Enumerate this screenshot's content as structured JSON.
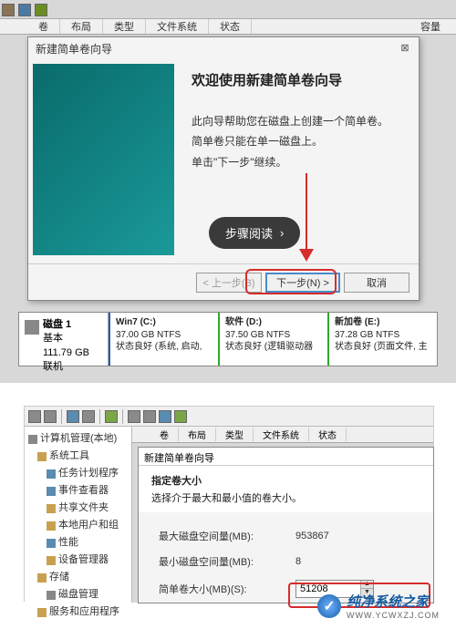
{
  "section1": {
    "toolbar": {
      "cols": [
        "卷",
        "布局",
        "类型",
        "文件系统",
        "状态"
      ],
      "last": "容量"
    },
    "wizard": {
      "title": "新建简单卷向导",
      "heading": "欢迎使用新建简单卷向导",
      "line1": "此向导帮助您在磁盘上创建一个简单卷。",
      "line2": "简单卷只能在单一磁盘上。",
      "line3": "单击\"下一步\"继续。",
      "step_button": "步骤阅读",
      "back": "< 上一步(B)",
      "next": "下一步(N) >",
      "cancel": "取消"
    },
    "disk": {
      "label_title": "磁盘 1",
      "label_sub1": "基本",
      "label_sub2": "111.79 GB",
      "label_sub3": "联机",
      "partitions": [
        {
          "name": "Win7 (C:)",
          "size": "37.00 GB NTFS",
          "status": "状态良好 (系统, 启动,",
          "color": "blue"
        },
        {
          "name": "软件 (D:)",
          "size": "37.50 GB NTFS",
          "status": "状态良好 (逻辑驱动器",
          "color": "green"
        },
        {
          "name": "新加卷 (E:)",
          "size": "37.28 GB NTFS",
          "status": "状态良好 (页面文件, 主",
          "color": "green"
        }
      ]
    }
  },
  "section2": {
    "tree": {
      "root": "计算机管理(本地)",
      "group1": "系统工具",
      "items1": [
        "任务计划程序",
        "事件查看器",
        "共享文件夹",
        "本地用户和组",
        "性能",
        "设备管理器"
      ],
      "group2": "存储",
      "items2": [
        "磁盘管理"
      ],
      "group3": "服务和应用程序"
    },
    "tabs": [
      "卷",
      "布局",
      "类型",
      "文件系统",
      "状态"
    ],
    "wizard": {
      "title": "新建简单卷向导",
      "sub_h": "指定卷大小",
      "sub_t": "选择介于最大和最小值的卷大小。",
      "rows": [
        {
          "label": "最大磁盘空间量(MB):",
          "value": "953867"
        },
        {
          "label": "最小磁盘空间量(MB):",
          "value": "8"
        },
        {
          "label": "简单卷大小(MB)(S):",
          "value": "51208"
        }
      ]
    }
  },
  "watermark": {
    "text": "纯净系统之家",
    "sub": "WWW.YCWXZJ.COM"
  }
}
